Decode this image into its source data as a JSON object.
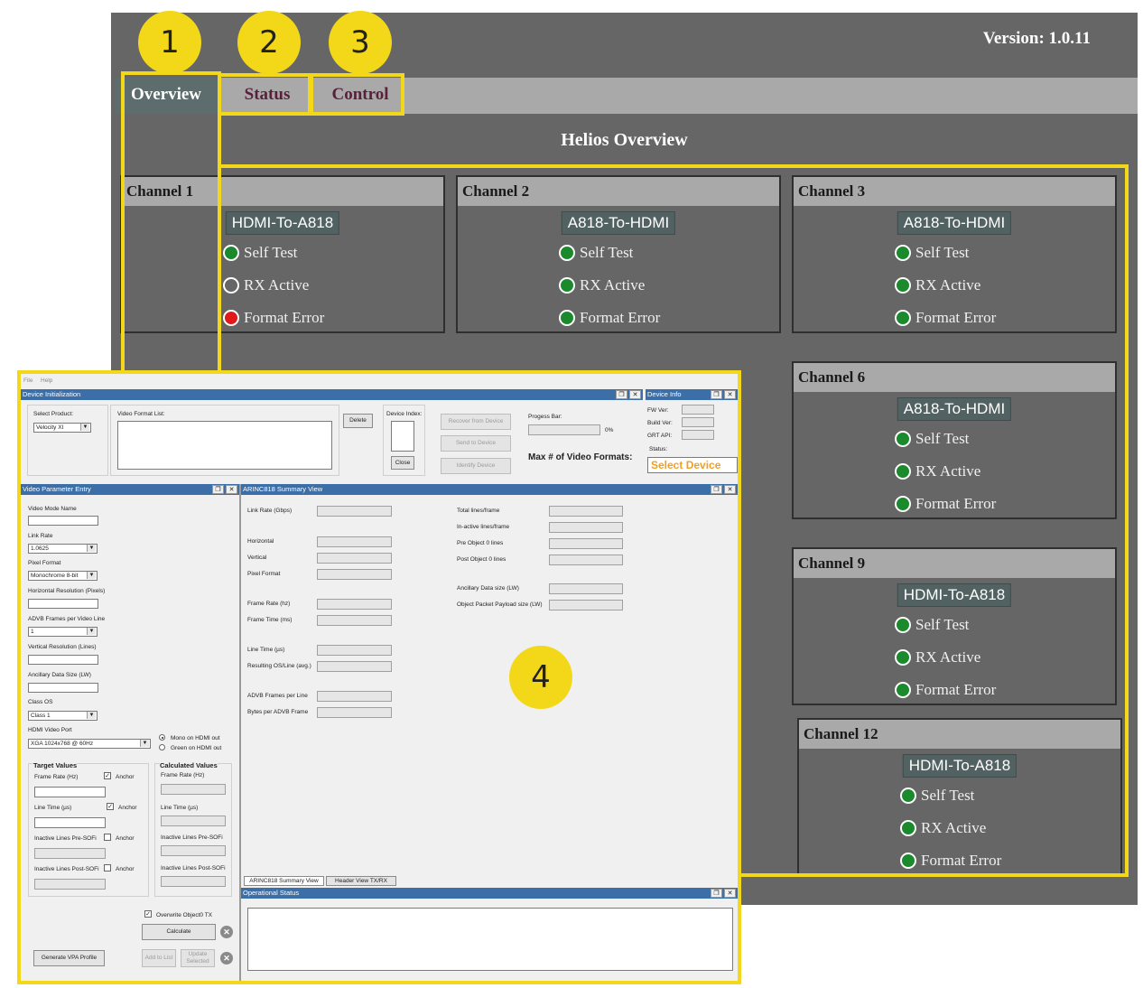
{
  "helios": {
    "version": "Version: 1.0.11",
    "tabs": [
      "Overview",
      "Status",
      "Control"
    ],
    "overview_title": "Helios Overview",
    "indicators": [
      "Self Test",
      "RX Active",
      "Format Error"
    ],
    "channels": [
      {
        "name": "Channel 1",
        "mode": "HDMI-To-A818",
        "self_test": "green",
        "rx_active": "off",
        "format_error": "red"
      },
      {
        "name": "Channel 2",
        "mode": "A818-To-HDMI",
        "self_test": "green",
        "rx_active": "green",
        "format_error": "green"
      },
      {
        "name": "Channel 3",
        "mode": "A818-To-HDMI",
        "self_test": "green",
        "rx_active": "green",
        "format_error": "green"
      },
      {
        "name": "Channel 6",
        "mode": "A818-To-HDMI",
        "self_test": "green",
        "rx_active": "green",
        "format_error": "green"
      },
      {
        "name": "Channel 9",
        "mode": "HDMI-To-A818",
        "self_test": "green",
        "rx_active": "green",
        "format_error": "green"
      },
      {
        "name": "Channel 12",
        "mode": "HDMI-To-A818",
        "self_test": "green",
        "rx_active": "green",
        "format_error": "green"
      }
    ]
  },
  "callouts": [
    "1",
    "2",
    "3",
    "4"
  ],
  "app": {
    "menu": [
      "File",
      "Help"
    ],
    "device_init": {
      "title": "Device Initialization",
      "select_product_label": "Select Product:",
      "select_product_value": "Velocity XI",
      "video_format_list_label": "Video Format List:",
      "delete": "Delete",
      "device_index_label": "Device Index:",
      "close": "Close",
      "recover": "Recover from Device",
      "send": "Send to Device",
      "identify": "Identify Device",
      "progress_label": "Progess Bar:",
      "progress_pct": "0%",
      "progress_value": 0,
      "max_formats": "Max # of Video Formats:"
    },
    "device_info": {
      "title": "Device Info",
      "fw": "FW Ver:",
      "build": "Build Ver:",
      "grt": "GRT API:",
      "status": "Status:",
      "status_value": "Select Device"
    },
    "vpe": {
      "title": "Video Parameter Entry",
      "video_mode_name": "Video Mode Name",
      "link_rate": "Link Rate",
      "link_rate_value": "1.0625",
      "pixel_format": "Pixel Format",
      "pixel_format_value": "Monochrome 8-bit",
      "h_res": "Horizontal Resolution (Pixels)",
      "advb_frames": "ADVB Frames per Video Line",
      "advb_frames_value": "1",
      "v_res": "Vertical Resolution (Lines)",
      "ancillary": "Ancillary Data Size (LW)",
      "class_os": "Class OS",
      "class_os_value": "Class 1",
      "hdmi_port": "HDMI Video Port",
      "hdmi_port_value": "XGA 1024x768 @ 60Hz",
      "mono": "Mono on HDMI out",
      "green": "Green on HDMI out",
      "target_title": "Target Values",
      "calc_title": "Calculated Values",
      "frame_rate": "Frame Rate (Hz)",
      "line_time": "Line Time (µs)",
      "inactive_pre": "Inactive Lines Pre-SOFi",
      "inactive_post": "Inactive Lines Post-SOFi",
      "anchor": "Anchor",
      "overwrite": "Overwrite Object0 TX",
      "calculate": "Calculate",
      "generate": "Generate VPA Profile",
      "add": "Add to List",
      "update": "Update Selected"
    },
    "summary": {
      "title": "ARINC818 Summary View",
      "left": [
        "Link Rate (Gbps)",
        "Horizontal",
        "Vertical",
        "Pixel Format",
        "Frame Rate (hz)",
        "Frame Time (ms)",
        "Line Time (µs)",
        "Resulting OS/Line (avg.)",
        "ADVB Frames per Line",
        "Bytes per ADVB Frame"
      ],
      "right": [
        "Total lines/frame",
        "In-active lines/frame",
        "Pre Object 0 lines",
        "Post Object 0 lines",
        "Ancillary  Data size (LW)",
        "Object Packet Payload size (LW)"
      ],
      "tabs": [
        "ARINC818 Summary View",
        "Header View TX/RX"
      ]
    },
    "op_status": {
      "title": "Operational Status"
    }
  }
}
